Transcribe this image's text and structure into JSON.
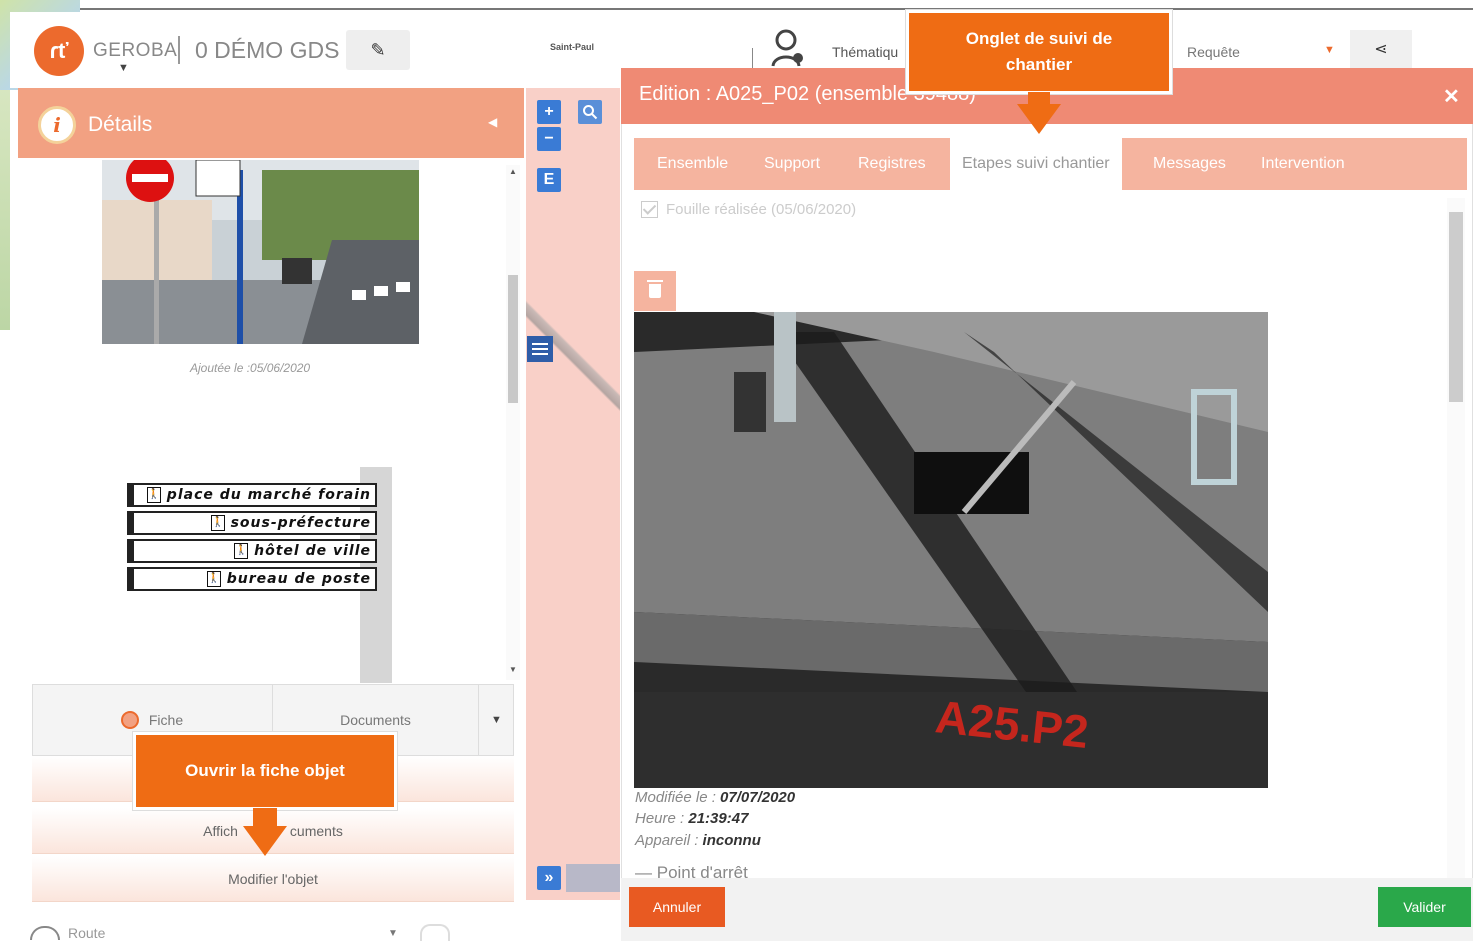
{
  "header": {
    "brand": "GEROBA",
    "project": "0 DÉMO GDS",
    "municipality_logo_text": "Saint-Paul",
    "thematic_label": "Thématiqu",
    "query_label": "Requête"
  },
  "details_panel": {
    "title": "Détails",
    "photo_caption": "Ajoutée le :05/06/2020",
    "direction_signs": [
      "place du marché forain",
      "sous-préfecture",
      "hôtel de ville",
      "bureau de poste"
    ],
    "fiche_label": "Fiche",
    "documents_label": "Documents",
    "menu": {
      "show_documents": "Affich",
      "show_documents_suffix": "cuments",
      "modify_object": "Modifier l'objet"
    },
    "bottom_layer_label": "Route"
  },
  "map_controls": {
    "zoom_in": "+",
    "zoom_out": "−",
    "search_icon": "search-icon",
    "edit_mode": "E",
    "expand": "»"
  },
  "dialog": {
    "title": "Edition : A025_P02 (ensemble 39488)",
    "tabs": [
      "Ensemble",
      "Support",
      "Registres",
      "Etapes suivi chantier",
      "Messages",
      "Intervention"
    ],
    "active_tab": "Etapes suivi chantier",
    "checkbox_label": "Fouille réalisée (05/06/2020)",
    "photo_marking": "A25.P2",
    "meta": {
      "modified_label": "Modifiée le :",
      "modified_value": "07/07/2020",
      "time_label": "Heure :",
      "time_value": "21:39:47",
      "device_label": "Appareil :",
      "device_value": "inconnu"
    },
    "section_label": "Point d'arrêt",
    "cancel_label": "Annuler",
    "validate_label": "Valider"
  },
  "callouts": {
    "tab_callout": "Onglet de suivi de chantier",
    "open_callout": "Ouvrir la fiche objet"
  },
  "colors": {
    "accent_orange": "#ef6c14",
    "panel_salmon": "#f2a182",
    "dialog_header": "#ef8a74",
    "validate_green": "#2aa84a",
    "map_button_blue": "#3a7bd5"
  }
}
